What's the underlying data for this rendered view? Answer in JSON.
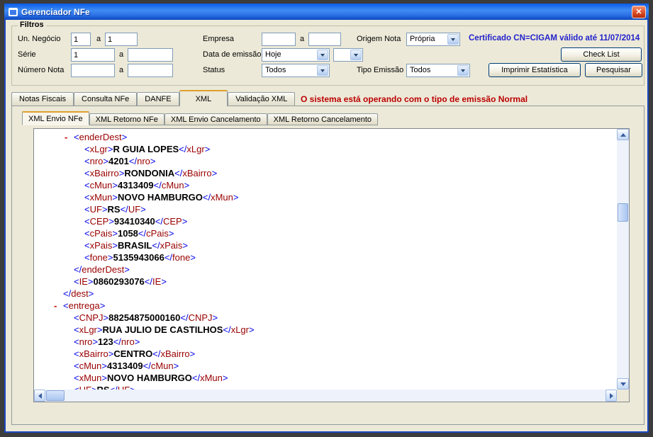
{
  "window": {
    "title": "Gerenciador NFe",
    "close_glyph": "✕"
  },
  "filters": {
    "legend": "Filtros",
    "range_sep": "a",
    "un_negocio": {
      "label": "Un. Negócio",
      "from": "1",
      "to": "1"
    },
    "serie": {
      "label": "Série",
      "from": "1",
      "to": ""
    },
    "numero_nota": {
      "label": "Número Nota",
      "from": "",
      "to": ""
    },
    "empresa": {
      "label": "Empresa",
      "from": "",
      "to": ""
    },
    "data_emissao": {
      "label": "Data de emissão",
      "value": "Hoje",
      "value2": ""
    },
    "status": {
      "label": "Status",
      "value": "Todos"
    },
    "origem_nota": {
      "label": "Origem Nota",
      "value": "Própria"
    },
    "tipo_emissao": {
      "label": "Tipo Emissão",
      "value": "Todos"
    },
    "certificate_text": "Certificado CN=CIGAM válido até 11/07/2014",
    "buttons": {
      "check_list": "Check List",
      "imprimir": "Imprimir Estatística",
      "pesquisar": "Pesquisar"
    }
  },
  "main_tabs": {
    "items": [
      "Notas Fiscais",
      "Consulta NFe",
      "DANFE",
      "XML",
      "Validação XML"
    ],
    "active": "XML",
    "status_message": "O sistema está operando com o tipo de emissão Normal"
  },
  "xml_tabs": {
    "items": [
      "XML Envio NFe",
      "XML Retorno NFe",
      "XML Envio Cancelamento",
      "XML Retorno Cancelamento"
    ],
    "active": "XML Envio NFe"
  },
  "xml_view": {
    "lines": [
      {
        "indent": 2,
        "dash": true,
        "type": "open",
        "tag": "enderDest"
      },
      {
        "indent": 3,
        "dash": false,
        "type": "leaf",
        "tag": "xLgr",
        "value": "R GUIA LOPES"
      },
      {
        "indent": 3,
        "dash": false,
        "type": "leaf",
        "tag": "nro",
        "value": "4201"
      },
      {
        "indent": 3,
        "dash": false,
        "type": "leaf",
        "tag": "xBairro",
        "value": "RONDONIA"
      },
      {
        "indent": 3,
        "dash": false,
        "type": "leaf",
        "tag": "cMun",
        "value": "4313409"
      },
      {
        "indent": 3,
        "dash": false,
        "type": "leaf",
        "tag": "xMun",
        "value": "NOVO HAMBURGO"
      },
      {
        "indent": 3,
        "dash": false,
        "type": "leaf",
        "tag": "UF",
        "value": "RS"
      },
      {
        "indent": 3,
        "dash": false,
        "type": "leaf",
        "tag": "CEP",
        "value": "93410340"
      },
      {
        "indent": 3,
        "dash": false,
        "type": "leaf",
        "tag": "cPais",
        "value": "1058"
      },
      {
        "indent": 3,
        "dash": false,
        "type": "leaf",
        "tag": "xPais",
        "value": "BRASIL"
      },
      {
        "indent": 3,
        "dash": false,
        "type": "leaf",
        "tag": "fone",
        "value": "5135943066"
      },
      {
        "indent": 2,
        "dash": false,
        "type": "close",
        "tag": "enderDest"
      },
      {
        "indent": 2,
        "dash": false,
        "type": "leaf",
        "tag": "IE",
        "value": "0860293076"
      },
      {
        "indent": 1,
        "dash": false,
        "type": "close",
        "tag": "dest"
      },
      {
        "indent": 1,
        "dash": true,
        "type": "open",
        "tag": "entrega"
      },
      {
        "indent": 2,
        "dash": false,
        "type": "leaf",
        "tag": "CNPJ",
        "value": "88254875000160"
      },
      {
        "indent": 2,
        "dash": false,
        "type": "leaf",
        "tag": "xLgr",
        "value": "RUA JULIO DE CASTILHOS"
      },
      {
        "indent": 2,
        "dash": false,
        "type": "leaf",
        "tag": "nro",
        "value": "123"
      },
      {
        "indent": 2,
        "dash": false,
        "type": "leaf",
        "tag": "xBairro",
        "value": "CENTRO"
      },
      {
        "indent": 2,
        "dash": false,
        "type": "leaf",
        "tag": "cMun",
        "value": "4313409"
      },
      {
        "indent": 2,
        "dash": false,
        "type": "leaf",
        "tag": "xMun",
        "value": "NOVO HAMBURGO"
      },
      {
        "indent": 2,
        "dash": false,
        "type": "leaf",
        "tag": "UF",
        "value": "RS"
      }
    ]
  },
  "colors": {
    "certificate_blue": "#2222CC",
    "status_red": "#BB0000",
    "xml_bracket_blue": "#0000E6",
    "xml_tag_maroon": "#990000",
    "xml_value_black": "#000000",
    "xml_dash_red": "#C00000"
  }
}
